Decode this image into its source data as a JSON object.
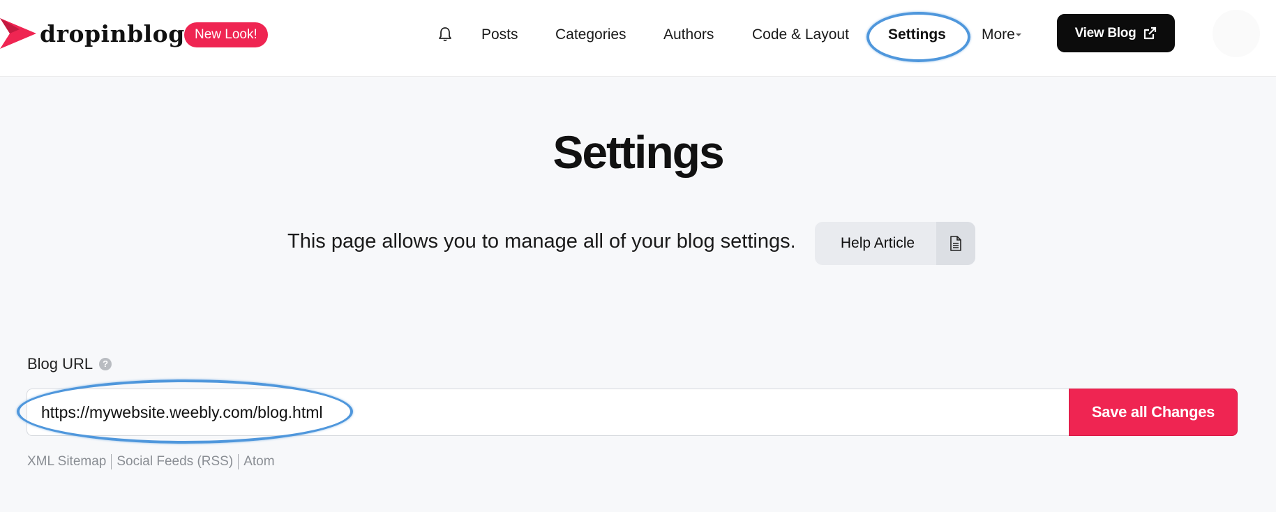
{
  "header": {
    "logo_text": "dropinblog",
    "badge": "New Look!",
    "nav": [
      {
        "label": "Posts"
      },
      {
        "label": "Categories"
      },
      {
        "label": "Authors"
      },
      {
        "label": "Code & Layout"
      },
      {
        "label": "Settings",
        "active": true
      },
      {
        "label": "More"
      }
    ],
    "view_blog": "View Blog",
    "icons": {
      "bell": "bell-icon",
      "external": "external-link-icon",
      "brand": "arrow-chevron-logo"
    }
  },
  "main": {
    "title": "Settings",
    "description": "This page allows you to manage all of your blog settings.",
    "help_button": "Help Article",
    "help_icon": "document-icon"
  },
  "blog_url": {
    "label": "Blog URL",
    "help_icon": "question-icon",
    "value": "https://mywebsite.weebly.com/blog.html",
    "save_button": "Save all Changes",
    "feed_links": [
      "XML Sitemap",
      "Social Feeds (RSS)",
      "Atom"
    ]
  },
  "colors": {
    "accent": "#ef2552",
    "annotation": "#4f97dc",
    "background": "#f7f8fa",
    "dark_button": "#0c0c0c"
  }
}
